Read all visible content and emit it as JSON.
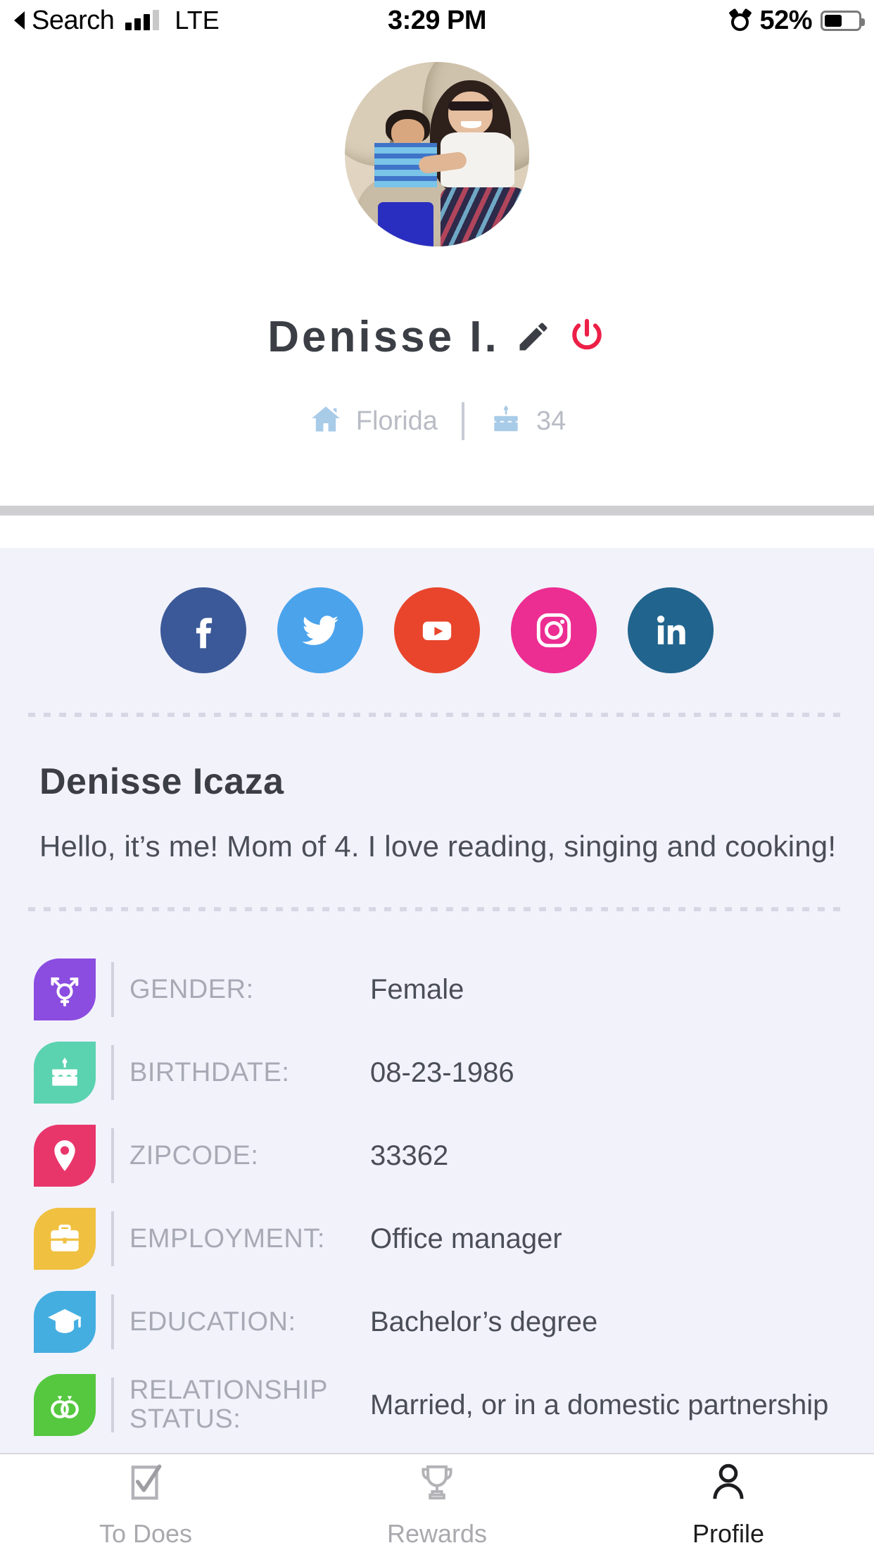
{
  "status_bar": {
    "back_label": "Search",
    "carrier": "LTE",
    "time": "3:29 PM",
    "battery_percent": "52%",
    "alarm_icon": "alarm-icon",
    "signal_icon": "signal-bars-icon",
    "battery_icon": "battery-icon"
  },
  "header": {
    "avatar_alt": "profile-photo",
    "display_name": "Denisse I.",
    "edit_icon": "pencil-edit-icon",
    "power_icon": "power-logout-icon",
    "home_icon": "home-icon",
    "location": "Florida",
    "cake_icon": "birthday-cake-icon",
    "age": "34"
  },
  "social": [
    {
      "name": "facebook",
      "label": "f",
      "color": "#3b5998"
    },
    {
      "name": "twitter",
      "label": "",
      "color": "#4ba3eb"
    },
    {
      "name": "youtube",
      "label": "",
      "color": "#e8452c"
    },
    {
      "name": "instagram",
      "label": "",
      "color": "#ec2d92"
    },
    {
      "name": "linkedin",
      "label": "in",
      "color": "#21648e"
    }
  ],
  "bio": {
    "full_name": "Denisse Icaza",
    "description": "Hello, it’s me! Mom of 4. I love reading, singing and cooking!"
  },
  "details": [
    {
      "icon": "gender-icon",
      "color": "#8b4de0",
      "label": "GENDER:",
      "value": "Female"
    },
    {
      "icon": "birthday-cake-icon",
      "color": "#5bd3b0",
      "label": "BIRTHDATE:",
      "value": "08-23-1986"
    },
    {
      "icon": "map-pin-icon",
      "color": "#e8366b",
      "label": "ZIPCODE:",
      "value": "33362"
    },
    {
      "icon": "briefcase-icon",
      "color": "#f0c040",
      "label": "EMPLOYMENT:",
      "value": "Office manager"
    },
    {
      "icon": "graduation-cap-icon",
      "color": "#44aee0",
      "label": "EDUCATION:",
      "value": "Bachelor’s degree"
    },
    {
      "icon": "rings-icon",
      "color": "#55c83f",
      "label": "RELATIONSHIP STATUS:",
      "value": "Married, or in a domestic partnership"
    }
  ],
  "tabs": [
    {
      "name": "to-does",
      "label": "To Does",
      "icon": "checklist-icon",
      "active": false
    },
    {
      "name": "rewards",
      "label": "Rewards",
      "icon": "trophy-icon",
      "active": false
    },
    {
      "name": "profile",
      "label": "Profile",
      "icon": "person-icon",
      "active": true
    }
  ],
  "colors": {
    "content_bg": "#f2f2fb",
    "accent_power": "#ec1f47",
    "text_dark": "#3b3f45",
    "text_muted": "#a7aab4"
  }
}
